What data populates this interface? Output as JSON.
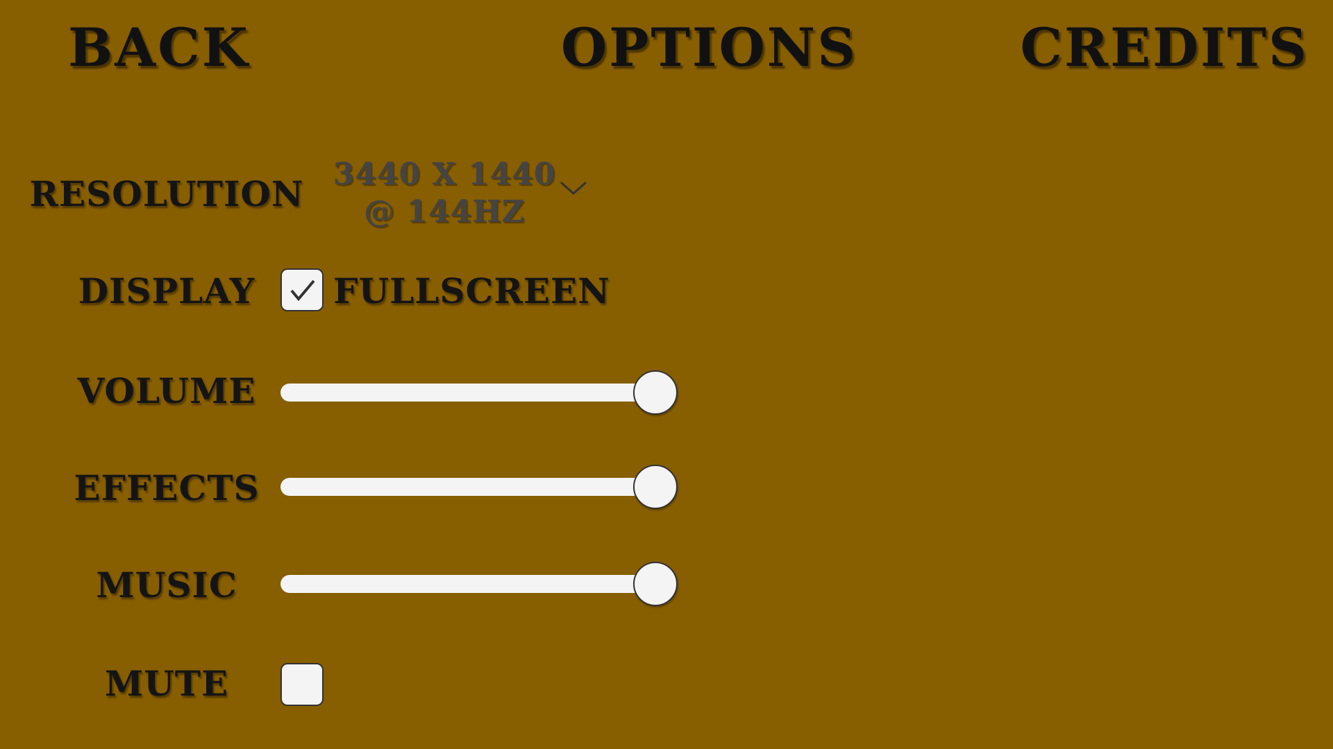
{
  "colors": {
    "background": "#875e00",
    "text": "#141414",
    "control": "#f4f4f4"
  },
  "nav": {
    "back": "BACK",
    "options": "OPTIONS",
    "credits": "CREDITS"
  },
  "settings": {
    "resolution": {
      "label": "RESOLUTION",
      "value": "3440 X 1440 @ 144HZ",
      "icon": "chevron-down-icon"
    },
    "display": {
      "label": "DISPLAY",
      "checkbox_label": "FULLSCREEN",
      "checked": true,
      "icon": "checkmark-icon"
    },
    "volume": {
      "label": "VOLUME",
      "level": 1.0
    },
    "effects": {
      "label": "EFFECTS",
      "level": 1.0
    },
    "music": {
      "label": "MUSIC",
      "level": 1.0
    },
    "mute": {
      "label": "MUTE",
      "checked": false
    }
  }
}
